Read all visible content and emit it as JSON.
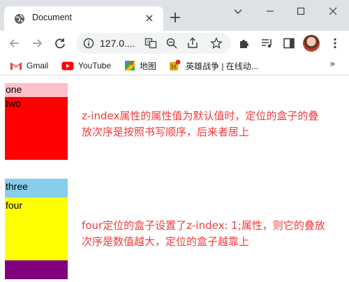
{
  "browser": {
    "tab_title": "Document",
    "address": "127.0....",
    "bookmarks": [
      {
        "label": "Gmail"
      },
      {
        "label": "YouTube"
      },
      {
        "label": "地图"
      },
      {
        "label": "英雄战争 | 在线动..."
      }
    ],
    "more_bookmarks": "»"
  },
  "page": {
    "box_one": "one",
    "box_two": "two",
    "box_three": "three",
    "box_four": "four",
    "desc1_line1": "z-index属性的属性值为默认值时，定位的盒子的叠",
    "desc1_line2": "放次序是按照书写顺序，后来者居上",
    "desc2_line1": "four定位的盒子设置了z-index: 1;属性，则它的叠放",
    "desc2_line2": "次序是数值越大，定位的盒子越靠上"
  },
  "colors": {
    "pink": "#ffc0cb",
    "red": "#ff0000",
    "skyblue": "#87ceeb",
    "yellow": "#ffff00",
    "purple": "#800080",
    "text_red": "#f23b3b"
  }
}
